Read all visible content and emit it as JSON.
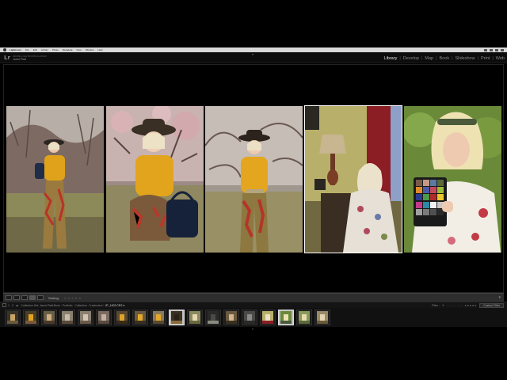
{
  "menubar": {
    "app": "Lightroom",
    "items": [
      "File",
      "Edit",
      "Library",
      "Photo",
      "Metadata",
      "View",
      "Window",
      "Help"
    ]
  },
  "identity": {
    "logo": "Lr",
    "line1": "ADOBE LIGHTROOM CLASSIC",
    "line2": "Jared Platt"
  },
  "modules": [
    {
      "label": "Library",
      "active": true
    },
    {
      "label": "Develop",
      "active": false
    },
    {
      "label": "Map",
      "active": false
    },
    {
      "label": "Book",
      "active": false
    },
    {
      "label": "Slideshow",
      "active": false
    },
    {
      "label": "Print",
      "active": false
    },
    {
      "label": "Web",
      "active": false
    }
  ],
  "survey": {
    "photos": [
      {
        "id": "orchard-standing",
        "selected": false
      },
      {
        "id": "orchard-crouching",
        "selected": false
      },
      {
        "id": "orchard-hat",
        "selected": false
      },
      {
        "id": "interior-lamp",
        "selected": true
      },
      {
        "id": "colorchecker",
        "selected": false
      }
    ]
  },
  "toolbar": {
    "sort_label": "Sorting:",
    "stars": "☆☆☆☆☆",
    "arrow": "▾"
  },
  "filmstrip_bar": {
    "page1": "1",
    "page2": "2",
    "source": "Collection Set: Jared Platt Book : Portfolio",
    "count": "Collection : 5 selected /",
    "file": "JP_1002.CR2 ▾",
    "filter_label": "Filter :",
    "filter_value": "Custom Filter"
  },
  "filmstrip": {
    "thumb_count": 18,
    "selected": [
      9,
      15
    ]
  },
  "colors": {
    "active_module": "#e6e6e6",
    "inactive_module": "#8a8a8a",
    "panel": "#2e2e2e"
  }
}
